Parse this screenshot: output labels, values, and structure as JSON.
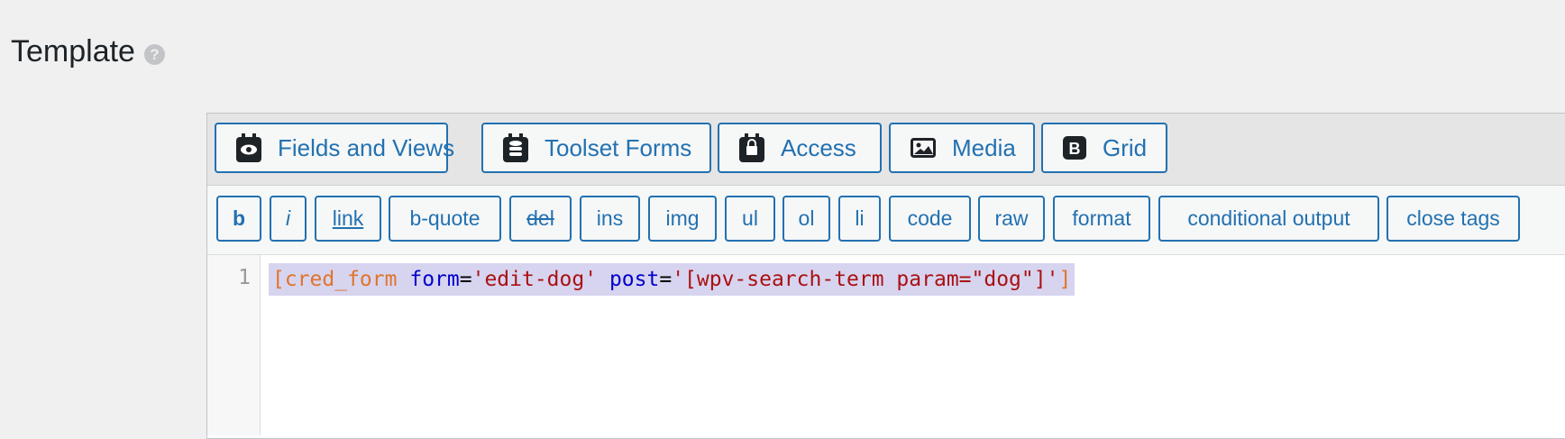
{
  "section": {
    "title": "Template",
    "help_glyph": "?"
  },
  "toolbar": {
    "buttons": [
      {
        "label": "Fields and Views",
        "icon": "eye-icon"
      },
      {
        "label": "Toolset Forms",
        "icon": "database-icon"
      },
      {
        "label": "Access",
        "icon": "lock-icon"
      },
      {
        "label": "Media",
        "icon": "image-icon"
      },
      {
        "label": "Grid",
        "icon": "bootstrap-icon"
      }
    ]
  },
  "quicktags": [
    "b",
    "i",
    "link",
    "b-quote",
    "del",
    "ins",
    "img",
    "ul",
    "ol",
    "li",
    "code",
    "raw",
    "format",
    "conditional output",
    "close tags"
  ],
  "code": {
    "line_number": "1",
    "tokens": [
      {
        "text": "[cred_form",
        "color": "#e0742a"
      },
      {
        "text": " ",
        "color": "#000000"
      },
      {
        "text": "form",
        "color": "#0000cc"
      },
      {
        "text": "=",
        "color": "#000000"
      },
      {
        "text": "'edit-dog'",
        "color": "#aa1111"
      },
      {
        "text": " ",
        "color": "#000000"
      },
      {
        "text": "post",
        "color": "#0000cc"
      },
      {
        "text": "=",
        "color": "#000000"
      },
      {
        "text": "'[wpv-search-term param=\"dog\"]'",
        "color": "#aa1111"
      },
      {
        "text": "]",
        "color": "#e0742a"
      }
    ],
    "selection_color": "#d7d4f0"
  },
  "colors": {
    "accent": "#2271b1",
    "page_bg": "#f0f0f1"
  }
}
